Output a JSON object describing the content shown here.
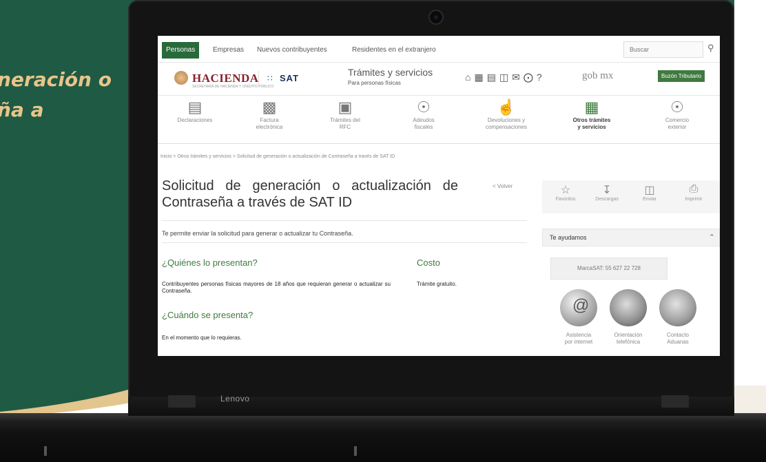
{
  "hero": {
    "line1": "",
    "line2": "neración o",
    "line3": "ña a"
  },
  "laptop": {
    "brand": "Lenovo"
  },
  "topnav": {
    "tabs": [
      "Personas",
      "Empresas",
      "Nuevos contribuyentes",
      "Residentes en el extranjero"
    ],
    "search_placeholder": "Buscar"
  },
  "header": {
    "hacienda": "HACIENDA",
    "hacienda_sub": "SECRETARÍA DE HACIENDA Y CRÉDITO PÚBLICO",
    "sat": "SAT",
    "tramites_title": "Trámites y servicios",
    "tramites_sub": "Para personas físicas",
    "gob": "gob mx",
    "buzon": "Buzón Tributario"
  },
  "categories": [
    {
      "label1": "Declaraciones",
      "label2": "",
      "icon": "building-icon"
    },
    {
      "label1": "Factura",
      "label2": "electrónica",
      "icon": "invoice-icon"
    },
    {
      "label1": "Trámites del",
      "label2": "RFC",
      "icon": "rfc-icon"
    },
    {
      "label1": "Adeudos",
      "label2": "fiscales",
      "icon": "debt-icon"
    },
    {
      "label1": "Devoluciones y",
      "label2": "compensaciones",
      "icon": "refund-icon"
    },
    {
      "label1": "Otros trámites",
      "label2": "y servicios",
      "icon": "other-icon"
    },
    {
      "label1": "Comercio",
      "label2": "exterior",
      "icon": "trade-icon"
    }
  ],
  "breadcrumb": "Inicio > Otros trámites y servicios > Solicitud de generación o actualización de Contraseña a través de SAT ID",
  "page": {
    "title": "Solicitud de generación o actualización de Contraseña a través de SAT ID",
    "volver": "< Volver",
    "intro": "Te permite enviar la solicitud para generar o actualizar tu Contraseña.",
    "who_heading": "¿Quiénes lo presentan?",
    "who_text": "Contribuyentes personas físicas mayores de 18 años que requieran generar o actualizar su Contraseña.",
    "cost_heading": "Costo",
    "cost_text": "Trámite gratuito.",
    "when_heading": "¿Cuándo se presenta?",
    "when_text": "En el momento que lo requieras."
  },
  "actions": [
    "Favoritos",
    "Descargas",
    "Enviar",
    "Imprimir"
  ],
  "help": {
    "heading": "Te ayudamos",
    "phone": "MarcaSAT: 55 627 22 728",
    "items": [
      {
        "label1": "Asistencia",
        "label2": "por internet"
      },
      {
        "label1": "Orientación",
        "label2": "telefónica"
      },
      {
        "label1": "Contacto",
        "label2": "Aduanas"
      }
    ]
  },
  "colors": {
    "background": "#1f5a44",
    "accent_text": "#e8c58a",
    "sat_green": "#3d7c3d",
    "hacienda": "#8a1f2c"
  }
}
